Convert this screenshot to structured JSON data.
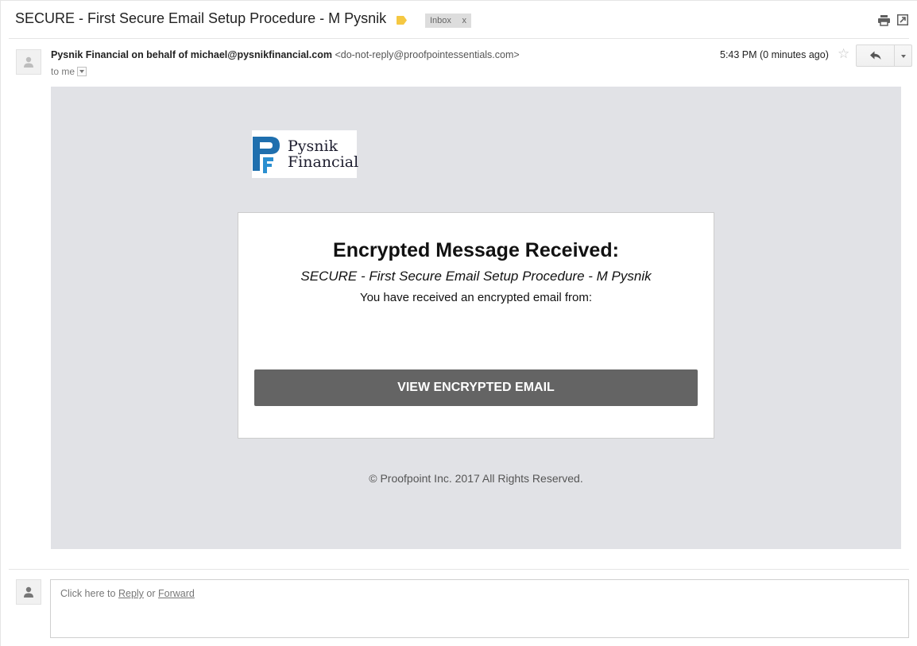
{
  "subject": "SECURE - First Secure Email Setup Procedure - M Pysnik",
  "labels": {
    "inbox": "Inbox",
    "remove": "x"
  },
  "sender": {
    "name": "Pysnik Financial on behalf of michael@pysnikfinancial.com",
    "address": "<do-not-reply@proofpointessentials.com>",
    "to": "to me",
    "timestamp": "5:43 PM (0 minutes ago)"
  },
  "icons": {
    "label": "label-tag-icon",
    "print": "print-icon",
    "new_window": "new-window-icon",
    "star": "star-icon",
    "reply": "reply-icon",
    "avatar": "person-icon"
  },
  "message": {
    "logo_line1": "Pysnik",
    "logo_line2": "Financial",
    "title": "Encrypted Message Received:",
    "subject": "SECURE - First Secure Email Setup Procedure - M Pysnik",
    "from_text": "You have received an encrypted email from:",
    "button": "VIEW ENCRYPTED EMAIL",
    "copyright": "© Proofpoint Inc. 2017 All Rights Reserved."
  },
  "reply_box": {
    "prefix": "Click here to",
    "reply": "Reply",
    "or": "or",
    "forward": "Forward"
  },
  "colors": {
    "message_bg": "#e1e2e6",
    "button_bg": "#646464",
    "label_tag": "#f5c842",
    "logo_blue": "#1f6fae"
  }
}
